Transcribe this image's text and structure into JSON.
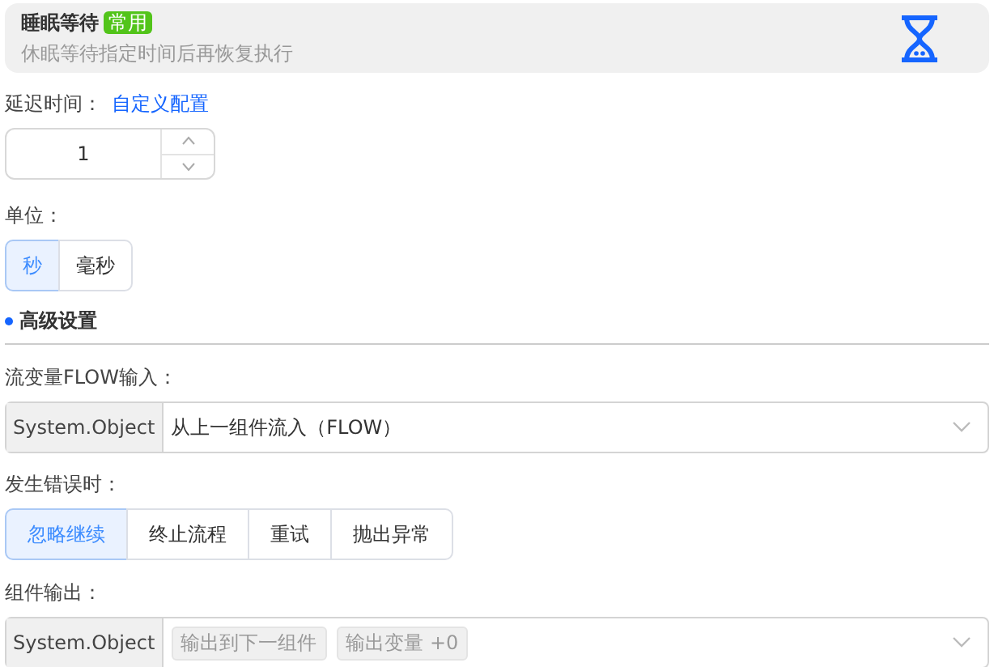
{
  "header": {
    "title": "睡眠等待",
    "badge": "常用",
    "description": "休眠等待指定时间后再恢复执行"
  },
  "delay": {
    "label": "延迟时间：",
    "link": "自定义配置",
    "value": "1"
  },
  "unit": {
    "label": "单位：",
    "options": [
      {
        "label": "秒",
        "selected": true
      },
      {
        "label": "毫秒",
        "selected": false
      }
    ]
  },
  "advanced": {
    "title": "高级设置"
  },
  "flow_input": {
    "label": "流变量FLOW输入：",
    "type": "System.Object",
    "value": "从上一组件流入（FLOW）"
  },
  "on_error": {
    "label": "发生错误时：",
    "options": [
      {
        "label": "忽略继续",
        "selected": true
      },
      {
        "label": "终止流程",
        "selected": false
      },
      {
        "label": "重试",
        "selected": false
      },
      {
        "label": "抛出异常",
        "selected": false
      }
    ]
  },
  "output": {
    "label": "组件输出：",
    "type": "System.Object",
    "tags": [
      "输出到下一组件",
      "输出变量 +0"
    ]
  }
}
